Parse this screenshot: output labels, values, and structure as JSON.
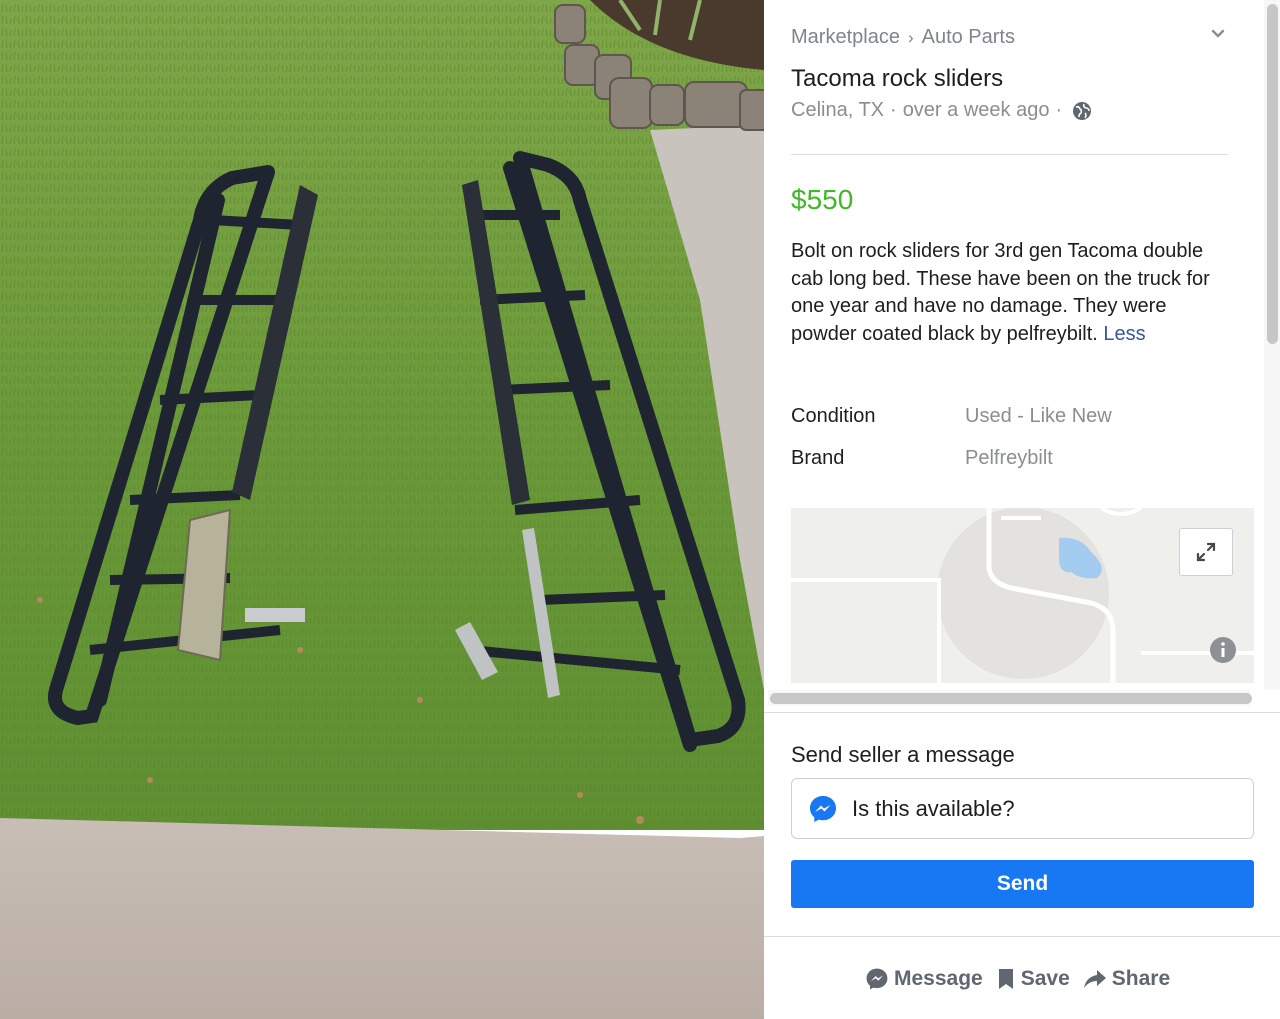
{
  "listing": {
    "breadcrumb": [
      "Marketplace",
      "Auto Parts"
    ],
    "breadcrumb_separator": "›",
    "title": "Tacoma rock sliders",
    "location": "Celina, TX",
    "posted": "over a week ago",
    "meta_separator": "·",
    "price": "$550",
    "description": "Bolt on rock sliders for 3rd gen Tacoma double cab long bed. These have been on the truck for one year and have no damage. They were powder coated black by pelfreybilt.",
    "less_link": "Less",
    "details": [
      {
        "label": "Condition",
        "value": "Used - Like New"
      },
      {
        "label": "Brand",
        "value": "Pelfreybilt"
      }
    ]
  },
  "message": {
    "heading": "Send seller a message",
    "input_value": "Is this available?",
    "send_label": "Send"
  },
  "actions": {
    "message": "Message",
    "save": "Save",
    "share": "Share"
  },
  "colors": {
    "price": "#42b72a",
    "link": "#385898",
    "send_button": "#1877f2",
    "muted_text": "#8a8d91"
  },
  "icons": [
    "chevron-down-icon",
    "globe-icon",
    "expand-icon",
    "info-icon",
    "messenger-icon",
    "bookmark-icon",
    "share-arrow-icon"
  ]
}
